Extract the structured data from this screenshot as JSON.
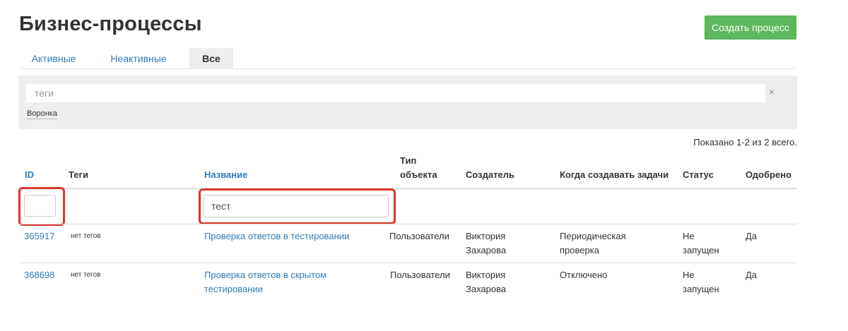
{
  "page": {
    "title": "Бизнес-процессы",
    "create_button": "Создать процесс"
  },
  "tabs": [
    {
      "label": "Активные"
    },
    {
      "label": "Неактивные"
    },
    {
      "label": "Все"
    }
  ],
  "filter": {
    "tags_placeholder": "теги",
    "clear_symbol": "×",
    "funnel_label": "Воронка"
  },
  "summary": "Показано 1-2 из 2 всего.",
  "table": {
    "headers": {
      "id": "ID",
      "tags": "Теги",
      "name": "Название",
      "object_type_line1": "Тип",
      "object_type_line2": "объекта",
      "creator": "Создатель",
      "when_create": "Когда создавать задачи",
      "status": "Статус",
      "approved": "Одобрено"
    },
    "filters": {
      "id_value": "",
      "name_value": "тест"
    },
    "rows": [
      {
        "id": "365917",
        "tags": "нет тегов",
        "name": "Проверка ответов в тестировании",
        "object_type": "Пользователи",
        "creator_line1": "Виктория",
        "creator_line2": "Захарова",
        "when_line1": "Периодическая",
        "when_line2": "проверка",
        "status_line1": "Не",
        "status_line2": "запущен",
        "approved": "Да"
      },
      {
        "id": "368698",
        "tags": "нет тегов",
        "name_line1": "Проверка ответов в скрытом",
        "name_line2": "тестировании",
        "object_type": "Пользователи",
        "creator_line1": "Виктория",
        "creator_line2": "Захарова",
        "when_line1": "Отключено",
        "status_line1": "Не",
        "status_line2": "запущен",
        "approved": "Да"
      }
    ]
  },
  "colors": {
    "accent": "#337ab7",
    "create_button": "#5cb85c",
    "highlight": "#d9372c"
  }
}
